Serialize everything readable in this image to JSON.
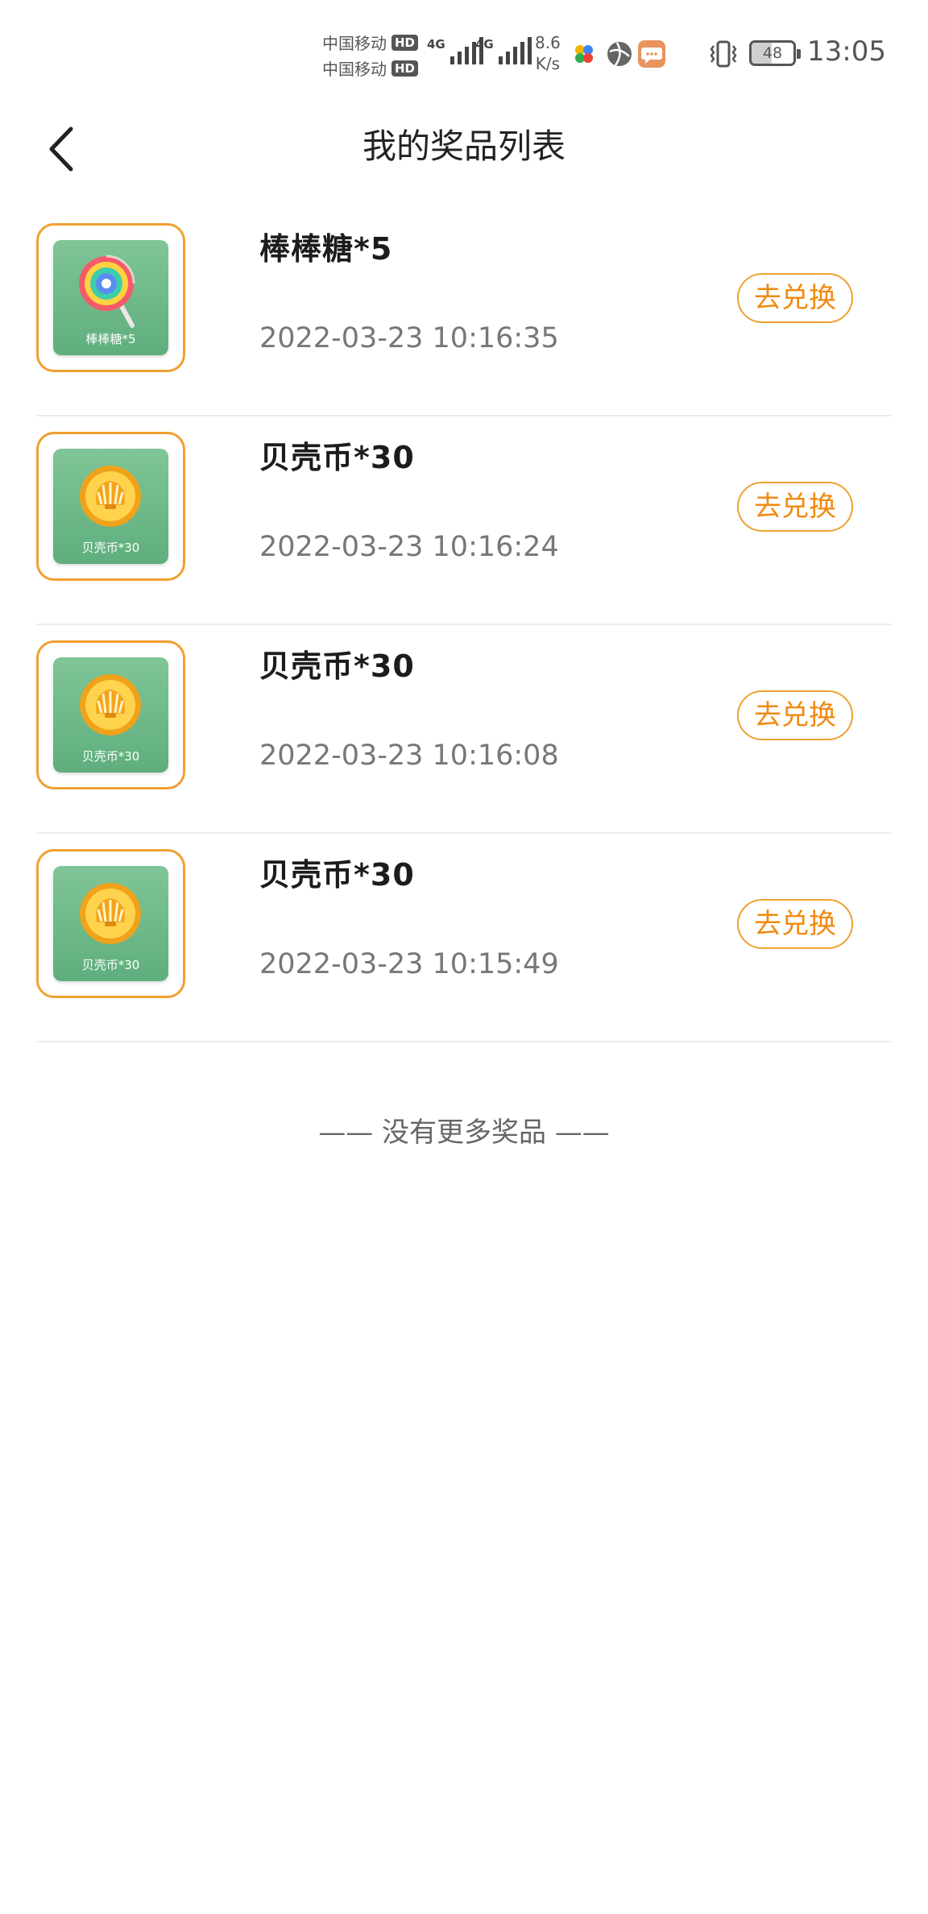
{
  "status_bar": {
    "carrier1": "中国移动",
    "carrier2": "中国移动",
    "hd_badge": "HD",
    "network1": "4G",
    "network2": "4G",
    "speed_value": "8.6",
    "speed_unit": "K/s",
    "battery": "48",
    "time": "13:05"
  },
  "header": {
    "back_icon": "chevron-left-icon",
    "title": "我的奖品列表"
  },
  "prizes": [
    {
      "thumb_caption": "棒棒糖*5",
      "icon": "lollipop-icon",
      "name": "棒棒糖*5",
      "time": "2022-03-23 10:16:35",
      "button": "去兑换"
    },
    {
      "thumb_caption": "贝壳币*30",
      "icon": "shell-coin-icon",
      "name": "贝壳币*30",
      "time": "2022-03-23 10:16:24",
      "button": "去兑换"
    },
    {
      "thumb_caption": "贝壳币*30",
      "icon": "shell-coin-icon",
      "name": "贝壳币*30",
      "time": "2022-03-23 10:16:08",
      "button": "去兑换"
    },
    {
      "thumb_caption": "贝壳币*30",
      "icon": "shell-coin-icon",
      "name": "贝壳币*30",
      "time": "2022-03-23 10:15:49",
      "button": "去兑换"
    }
  ],
  "footer_text": "—— 没有更多奖品 ——",
  "colors": {
    "accent": "#f08a10",
    "border_accent": "#f0a030",
    "thumb_bg": "#6db887"
  }
}
